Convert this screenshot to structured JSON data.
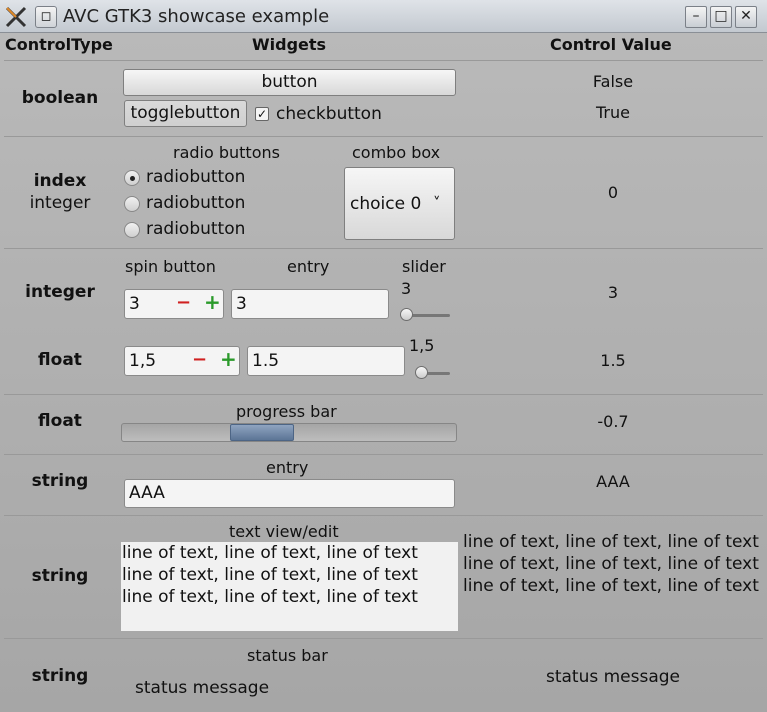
{
  "window": {
    "title": "AVC GTK3  showcase example",
    "menu_icon": "window-menu-icon",
    "controls": [
      "minimize-icon",
      "maximize-icon",
      "close-icon"
    ],
    "minimize_glyph": "–",
    "maximize_glyph": "□",
    "close_glyph": "✕"
  },
  "headers": {
    "control_type": "ControlType",
    "widgets": "Widgets",
    "control_value": "Control Value"
  },
  "rows": {
    "boolean": {
      "type": "boolean",
      "button_label": "button",
      "toggle_label": "togglebutton",
      "check_label": "checkbutton",
      "check_mark": "✓",
      "value_button": "False",
      "value_toggle": "True"
    },
    "index": {
      "type_line1": "index",
      "type_line2": "integer",
      "radio_caption": "radio buttons",
      "radios": [
        "radiobutton",
        "radiobutton",
        "radiobutton"
      ],
      "combo_caption": "combo box",
      "combo_value": "choice 0",
      "combo_arrow": "˅",
      "value": "0"
    },
    "integer": {
      "type": "integer",
      "spin_caption": "spin button",
      "entry_caption": "entry",
      "slider_caption": "slider",
      "spin_value": "3",
      "entry_value": "3",
      "slider_value": "3",
      "slider_fraction": 0.0,
      "value": "3"
    },
    "float": {
      "type": "float",
      "spin_value": "1,5",
      "entry_value": "1.5",
      "slider_value": "1,5",
      "slider_fraction": 0.0,
      "value": "1.5"
    },
    "progress": {
      "type": "float",
      "caption": "progress bar",
      "value": "-0.7"
    },
    "string_entry": {
      "type": "string",
      "caption": "entry",
      "entry_value": "AAA",
      "value": "AAA"
    },
    "string_text": {
      "type": "string",
      "caption": "text view/edit",
      "lines": [
        "line of text, line of text, line of text",
        "line of text, line of text, line of text",
        "line of text, line of text, line of text"
      ],
      "value_lines": [
        "line of text, line of text, line of text",
        "line of text, line of text, line of text",
        "line of text, line of text, line of text"
      ]
    },
    "string_status": {
      "type": "string",
      "caption": "status bar",
      "status_text": "status message",
      "value": "status message"
    }
  },
  "spin": {
    "minus": "−",
    "plus": "+"
  },
  "colors": {
    "progress_fill": "#6d86a6",
    "background": "#a9a9a9"
  }
}
